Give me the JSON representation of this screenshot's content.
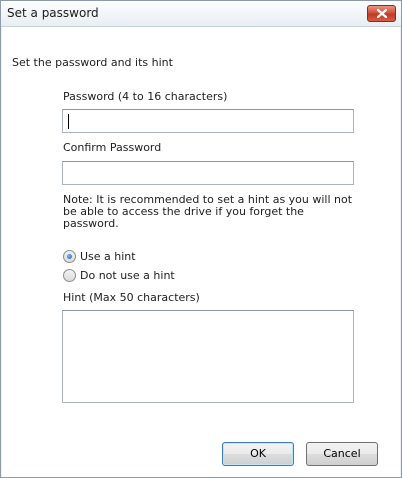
{
  "window": {
    "title": "Set a password"
  },
  "dialog": {
    "heading": "Set the password and its hint",
    "password_label": "Password (4 to 16 characters)",
    "password_value": "",
    "confirm_label": "Confirm Password",
    "confirm_value": "",
    "note": "Note: It is recommended to set a hint as you will not be able to access the drive if you forget the password.",
    "hint_options": [
      {
        "label": "Use a hint",
        "selected": true
      },
      {
        "label": "Do not use a hint",
        "selected": false
      }
    ],
    "hint_label": "Hint (Max 50 characters)",
    "hint_value": ""
  },
  "buttons": {
    "ok": "OK",
    "cancel": "Cancel"
  }
}
